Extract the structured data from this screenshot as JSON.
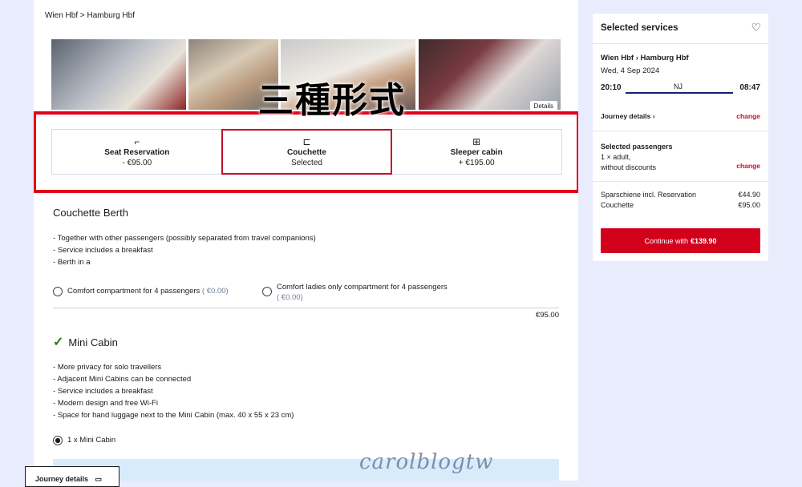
{
  "breadcrumb": "Wien Hbf > Hamburg Hbf",
  "photos": {
    "details_label": "Details"
  },
  "overlay_text": "三種形式",
  "options": [
    {
      "icon": "seat-icon",
      "glyph": "⌐",
      "title": "Seat Reservation",
      "subtitle": "- €95.00"
    },
    {
      "icon": "couchette-icon",
      "glyph": "⊏",
      "title": "Couchette",
      "subtitle": "Selected"
    },
    {
      "icon": "sleeper-icon",
      "glyph": "⊞",
      "title": "Sleeper cabin",
      "subtitle": "+ €195.00"
    }
  ],
  "couchette": {
    "title": "Couchette Berth",
    "bullets": [
      "Together with other passengers (possibly separated from travel companions)",
      "Service includes a breakfast",
      "Berth in a"
    ],
    "radio1": {
      "label": "Comfort compartment for 4 passengers",
      "price": "( €0.00)"
    },
    "radio2": {
      "label": "Comfort ladies only compartment for 4 passengers",
      "price": "( €0.00)"
    },
    "total": "€95.00"
  },
  "minicabin": {
    "title": "Mini Cabin",
    "bullets": [
      "More privacy for solo travellers",
      "Adjacent Mini Cabins can be connected",
      "Service includes a breakfast",
      "Modern design and free Wi-Fi",
      "Space for hand luggage next to the Mini Cabin (max. 40 x 55 x 23 cm)"
    ],
    "radio_label": "1 x Mini Cabin"
  },
  "watermark": "carolblogtw",
  "journey_button": "Journey details",
  "sidebar": {
    "title": "Selected services",
    "route": "Wien Hbf › Hamburg Hbf",
    "date": "Wed, 4 Sep 2024",
    "depart": "20:10",
    "train": "NJ",
    "arrive": "08:47",
    "journey_link": "Journey details ›",
    "change": "change",
    "pax_title": "Selected passengers",
    "pax_line1": "1 × adult,",
    "pax_line2": "without discounts",
    "items": [
      {
        "label": "Sparschiene incl. Reservation",
        "price": "€44.90"
      },
      {
        "label": "Couchette",
        "price": "€95.00"
      }
    ],
    "continue_label": "Continue with",
    "continue_price": "€139.90"
  },
  "colors": {
    "accent_red": "#d3001c",
    "background": "#e9ecfd",
    "train_line": "#1a1f74"
  }
}
